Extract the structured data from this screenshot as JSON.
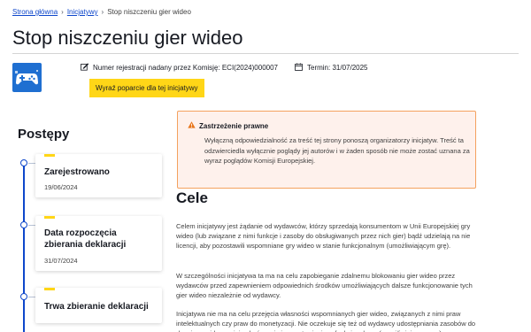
{
  "breadcrumb": {
    "home": "Strona główna",
    "initiatives": "Inicjatywy",
    "current": "Stop niszczeniu gier wideo"
  },
  "header": {
    "title": "Stop niszczeniu gier wideo",
    "registration": "Numer rejestracji nadany przez Komisję: ECI(2024)000007",
    "deadline": "Termin: 31/07/2025",
    "support_button": "Wyraź poparcie dla tej inicjatywy"
  },
  "progress": {
    "title": "Postępy",
    "steps": [
      {
        "label": "Zarejestrowano",
        "date": "19/06/2024"
      },
      {
        "label_line1": "Data rozpoczęcia",
        "label_line2": "zbierania deklaracji",
        "date": "31/07/2024"
      },
      {
        "label": "Trwa zbieranie deklaracji"
      }
    ]
  },
  "disclaimer": {
    "title": "Zastrzeżenie prawne",
    "body": "Wyłączną odpowiedzialność za treść tej strony ponoszą organizatorzy inicjatyw. Treść ta odzwierciedla wyłącznie poglądy jej autorów i w żaden sposób nie może zostać uznana za wyraz poglądów Komisji Europejskiej."
  },
  "goals": {
    "title": "Cele",
    "p1": "Celem inicjatywy jest żądanie od wydawców, którzy sprzedają konsumentom w Unii Europejskiej gry wideo (lub związane z nimi funkcje i zasoby do obsługiwanych przez nich gier) bądź udzielają na nie licencji, aby pozostawili wspomniane gry wideo w stanie funkcjonalnym (umożliwiającym grę).",
    "p2": "W szczególności inicjatywa ta ma na celu zapobieganie zdalnemu blokowaniu gier wideo przez wydawców przed zapewnieniem odpowiednich środków umożliwiających dalsze funkcjonowanie tych gier wideo niezależnie od wydawcy.",
    "p3": "Inicjatywa nie ma na celu przejęcia własności wspomnianych gier wideo, związanych z nimi praw intelektualnych czy praw do monetyzacji. Nie oczekuje się też od wydawcy udostępniania zasobów do danej gry wideo po jej zakończeniu i pozostawieniu w funkcjonalnym (umożliwiającym grę)"
  },
  "colors": {
    "link": "#0e47cb",
    "accent_yellow": "#ffd617",
    "warning_border": "#f4a15e",
    "warning_bg": "#fef1ec",
    "logo_blue": "#1f6fd1"
  },
  "icons": [
    "gamepad-logo-icon",
    "edit-icon",
    "calendar-icon",
    "warning-icon",
    "chevron-right-icon"
  ]
}
